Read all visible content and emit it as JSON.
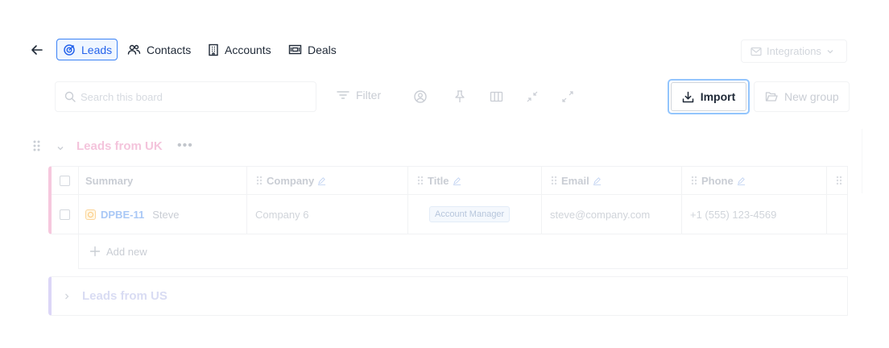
{
  "nav": {
    "tabs": [
      {
        "label": "Leads",
        "icon": "target-icon",
        "active": true
      },
      {
        "label": "Contacts",
        "icon": "users-icon",
        "active": false
      },
      {
        "label": "Accounts",
        "icon": "building-icon",
        "active": false
      },
      {
        "label": "Deals",
        "icon": "money-icon",
        "active": false
      }
    ],
    "integrations_label": "Integrations"
  },
  "toolbar": {
    "search_placeholder": "Search this board",
    "filter_label": "Filter",
    "import_label": "Import",
    "new_group_label": "New group"
  },
  "groups": [
    {
      "title": "Leads from UK",
      "columns": [
        "Summary",
        "Company",
        "Title",
        "Email",
        "Phone"
      ],
      "rows": [
        {
          "id": "DPBE-11",
          "name": "Steve",
          "company": "Company 6",
          "title": "Account Manager",
          "email": "steve@company.com",
          "phone": "+1 (555) 123-4569"
        }
      ],
      "add_new_label": "Add new"
    },
    {
      "title": "Leads from US"
    }
  ],
  "colors": {
    "accent": "#2563eb",
    "import_focus": "#93c5fd",
    "group_uk": "#f6c8de",
    "group_us": "#dcd6f7"
  }
}
